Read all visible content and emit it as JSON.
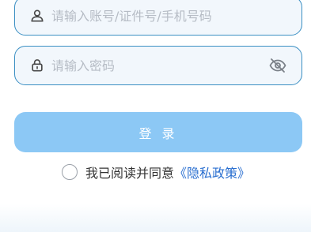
{
  "account_field": {
    "placeholder": "请输入账号/证件号/手机号码",
    "value": "",
    "icon": "user-icon"
  },
  "password_field": {
    "placeholder": "请输入密码",
    "value": "",
    "icon": "lock-icon",
    "visibility_icon": "eye-off-icon"
  },
  "login_button": {
    "label": "登 录"
  },
  "agreement": {
    "checked": false,
    "text": "我已阅读并同意",
    "link_label": "《隐私政策》"
  },
  "colors": {
    "field_border": "#3a8fc3",
    "field_background": "#f2f7fc",
    "button_background": "#8cc8f5",
    "link": "#2a6fd0",
    "icon": "#4a4a4a",
    "eye_icon": "#7a8088"
  }
}
